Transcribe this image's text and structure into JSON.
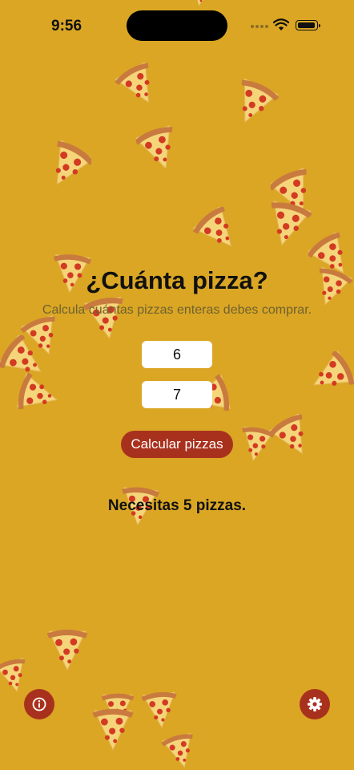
{
  "status_bar": {
    "time": "9:56"
  },
  "main": {
    "title": "¿Cuánta pizza?",
    "subtitle": "Calcula cuántas pizzas enteras debes comprar.",
    "input_people": "6",
    "input_slices": "7",
    "calc_button_label": "Calcular pizzas",
    "result_text": "Necesitas 5 pizzas."
  },
  "footer": {
    "info_icon": "info-icon",
    "settings_icon": "gear-icon"
  },
  "colors": {
    "background": "#DAA624",
    "accent": "#A8311D"
  }
}
